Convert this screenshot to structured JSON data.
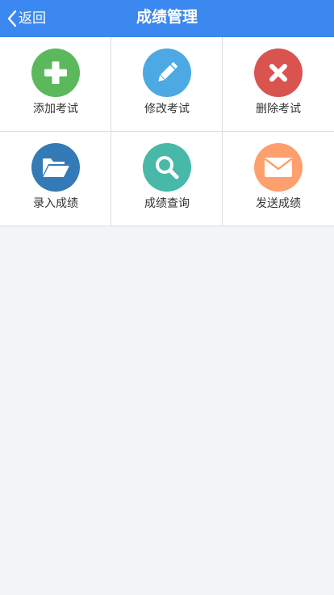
{
  "header": {
    "back_label": "返回",
    "title": "成绩管理",
    "background_color": "#3b88f0"
  },
  "menu": {
    "items": [
      {
        "label": "添加考试",
        "icon": "plus-icon",
        "color": "#5cb85c"
      },
      {
        "label": "修改考试",
        "icon": "pencil-icon",
        "color": "#4da9e4"
      },
      {
        "label": "删除考试",
        "icon": "close-icon",
        "color": "#d9534f"
      },
      {
        "label": "录入成绩",
        "icon": "folder-open-icon",
        "color": "#347ab7"
      },
      {
        "label": "成绩查询",
        "icon": "search-icon",
        "color": "#48b8a8"
      },
      {
        "label": "发送成绩",
        "icon": "envelope-icon",
        "color": "#fda06e"
      }
    ]
  }
}
